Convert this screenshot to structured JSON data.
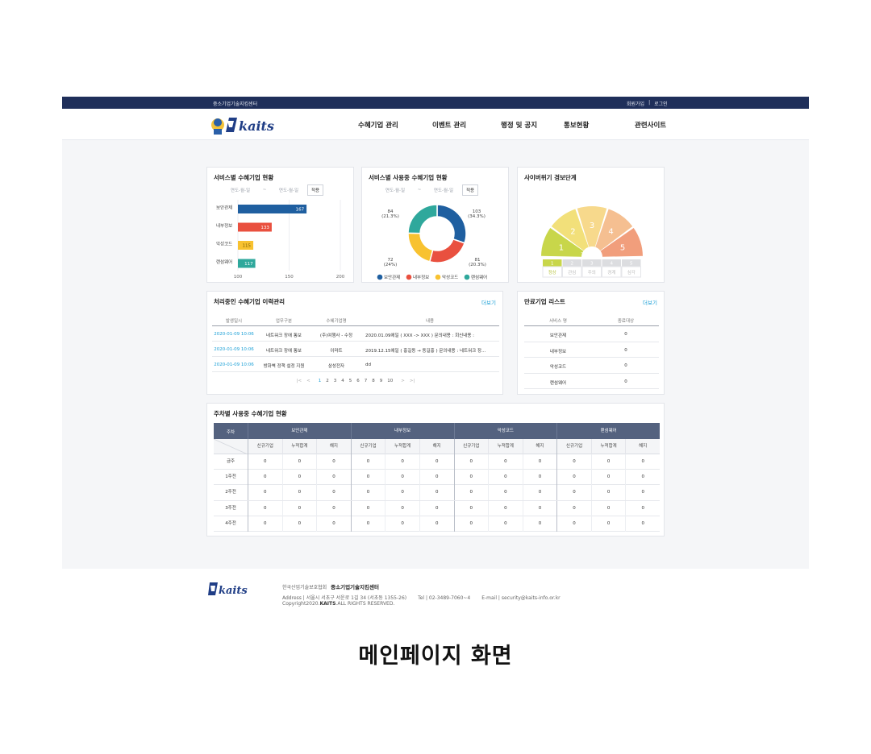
{
  "topbar": {
    "brand": "중소기업기술지킴센터",
    "join": "회원가입",
    "separator": "|",
    "login": "로그인"
  },
  "nav": [
    "수혜기업 관리",
    "이벤트 관리",
    "행정 및 공지",
    "통보현황",
    "관련사이트"
  ],
  "logo_text": "kaits",
  "service_chart": {
    "title": "서비스별 수혜기업 현황",
    "date_from": "연도-월-일",
    "date_sep": "~",
    "date_to": "연도-월-일",
    "apply": "적용",
    "chart_data": {
      "type": "bar",
      "orientation": "horizontal",
      "categories": [
        "보안관제",
        "내부정보",
        "악성코드",
        "랜섬웨어"
      ],
      "values": [
        167,
        133,
        115,
        117
      ],
      "colors": [
        "#1f5fa0",
        "#e9503f",
        "#f8c230",
        "#2fa89c"
      ],
      "xlim": [
        100,
        200
      ],
      "xticks": [
        "100",
        "150",
        "200"
      ],
      "grid": true
    }
  },
  "donut_chart": {
    "title": "서비스별 사용중 수혜기업 현황",
    "date_from": "연도-월-일",
    "date_sep": "~",
    "date_to": "연도-월-일",
    "apply": "적용",
    "chart_data": {
      "type": "pie",
      "categories": [
        "보안관제",
        "내부정보",
        "악성코드",
        "랜섬웨어"
      ],
      "values": [
        103,
        81,
        72,
        84
      ],
      "colors": [
        "#1f5fa0",
        "#e9503f",
        "#f8c230",
        "#2fa89c"
      ],
      "labels": [
        {
          "value": "103",
          "pct": "(34.3%)"
        },
        {
          "value": "81",
          "pct": "(20.3%)"
        },
        {
          "value": "72",
          "pct": "(24%)"
        },
        {
          "value": "84",
          "pct": "(21.3%)"
        }
      ],
      "legend": [
        "보안관제",
        "내부정보",
        "악성코드",
        "랜섬웨어"
      ]
    }
  },
  "cyber": {
    "title": "사이버위기 경보단계",
    "levels": [
      "1",
      "2",
      "3",
      "4",
      "5"
    ],
    "level_colors": [
      "#c8d64a",
      "#f2e07a",
      "#f7d98c",
      "#f5bf91",
      "#f19e7c"
    ],
    "names": [
      "정상",
      "관심",
      "주의",
      "경계",
      "심각"
    ],
    "current_level": 1
  },
  "history": {
    "title": "처리중인 수혜기업 이력관리",
    "more": "더보기",
    "columns": [
      "발생일시",
      "업무구분",
      "수혜기업명",
      "내용"
    ],
    "rows": [
      [
        "2020-01-09 10:06",
        "네트워크 장애 통보",
        "(주)여행사 - 수정",
        "2020.01.09에일 ( XXX -> XXX ) 문의내용 : 회신내용 :"
      ],
      [
        "2020-01-09 10:06",
        "네트워크 장애 통보",
        "이마트",
        "2019.12.15에일 ( 홍길동 → 동길홍 ) 문의내용 : 네트워크 장..."
      ],
      [
        "2020-01-09 10:06",
        "방화벽 정책 설정 지원",
        "삼성전자",
        "dd"
      ]
    ],
    "pages": [
      "1",
      "2",
      "3",
      "4",
      "5",
      "6",
      "7",
      "8",
      "9",
      "10"
    ],
    "first": "|<",
    "prev": "<",
    "next": ">",
    "last": ">|",
    "current_page": "1"
  },
  "ended": {
    "title": "만료기업 리스트",
    "more": "더보기",
    "columns": [
      "서비스 명",
      "종료대상"
    ],
    "rows": [
      [
        "보안관제",
        "0"
      ],
      [
        "내부정보",
        "0"
      ],
      [
        "악성코드",
        "0"
      ],
      [
        "랜섬웨어",
        "0"
      ]
    ]
  },
  "weekly": {
    "title": "주차별 사용중 수혜기업 현황",
    "week_header": "주차",
    "groups": [
      "보안관제",
      "내부정보",
      "악성코드",
      "랜섬웨어"
    ],
    "subcols": [
      "신규기업",
      "누적합계",
      "해지"
    ],
    "weeks": [
      "금주",
      "1주전",
      "2주전",
      "3주전",
      "4주전"
    ],
    "values": [
      [
        "0",
        "0",
        "0",
        "0",
        "0",
        "0",
        "0",
        "0",
        "0",
        "0",
        "0",
        "0"
      ],
      [
        "0",
        "0",
        "0",
        "0",
        "0",
        "0",
        "0",
        "0",
        "0",
        "0",
        "0",
        "0"
      ],
      [
        "0",
        "0",
        "0",
        "0",
        "0",
        "0",
        "0",
        "0",
        "0",
        "0",
        "0",
        "0"
      ],
      [
        "0",
        "0",
        "0",
        "0",
        "0",
        "0",
        "0",
        "0",
        "0",
        "0",
        "0",
        "0"
      ],
      [
        "0",
        "0",
        "0",
        "0",
        "0",
        "0",
        "0",
        "0",
        "0",
        "0",
        "0",
        "0"
      ]
    ]
  },
  "footer": {
    "org": "한국산업기술보호협회",
    "center": "중소기업기술지킴센터",
    "address": "Address | 서울시 서초구 서운로 1길 34 (서초동 1355-26)",
    "tel": "Tel | 02-3489-7060~4",
    "email": "E-mail | security@kaits-info.or.kr",
    "copy_prefix": "Copyright2020.",
    "copy_brand": "KAITS",
    "copy_suffix": ".ALL RIGHTS RESERVED."
  },
  "caption": "메인페이지 화면"
}
